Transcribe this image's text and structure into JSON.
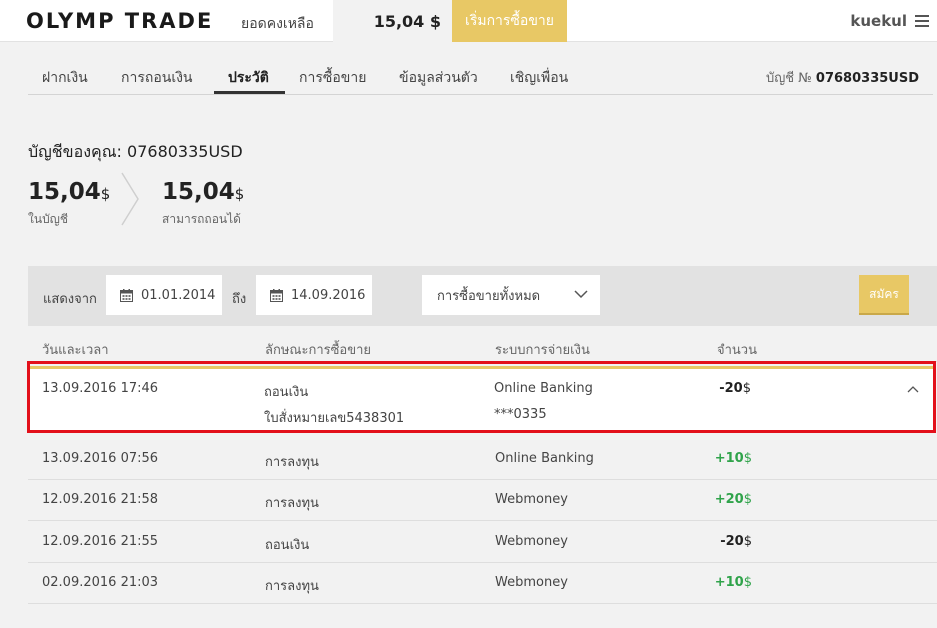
{
  "header": {
    "logo": "OLYMP TRADE",
    "balance_label": "ยอดคงเหลือ",
    "balance_value": "15,04 $",
    "start_trading": "เริ่มการซื้อขาย",
    "username": "kuekul"
  },
  "tabs": [
    {
      "label": "ฝากเงิน"
    },
    {
      "label": "การถอนเงิน"
    },
    {
      "label": "ประวัติ"
    },
    {
      "label": "การซื้อขาย"
    },
    {
      "label": "ข้อมูลส่วนตัว"
    },
    {
      "label": "เชิญเพื่อน"
    }
  ],
  "active_tab": "ประวัติ",
  "account": {
    "label_prefix": "บัญชี №",
    "number": "07680335USD",
    "title": "บัญชีของคุณ: 07680335USD",
    "in_account_value": "15,04",
    "in_account_currency": "$",
    "in_account_label": "ในบัญชี",
    "withdrawable_value": "15,04",
    "withdrawable_currency": "$",
    "withdrawable_label": "สามารถถอนได้"
  },
  "filter": {
    "from_label": "แสดงจาก",
    "from_date": "01.01.2014",
    "to_label": "ถึง",
    "to_date": "14.09.2016",
    "type_select": "การซื้อขายทั้งหมด",
    "apply_label": "สมัคร"
  },
  "table": {
    "headers": {
      "datetime": "วันและเวลา",
      "type": "ลักษณะการซื้อขาย",
      "payment": "ระบบการจ่ายเงิน",
      "amount": "จำนวน"
    },
    "expanded_row": {
      "datetime": "13.09.2016 17:46",
      "type": "ถอนเงิน",
      "order": "ใบสั่งหมายเลข5438301",
      "payment": "Online Banking",
      "account": "***0335",
      "amount": "-20",
      "currency": "$"
    },
    "rows": [
      {
        "datetime": "13.09.2016 07:56",
        "type": "การลงทุน",
        "payment": "Online Banking",
        "amount": "+10",
        "currency": "$"
      },
      {
        "datetime": "12.09.2016 21:58",
        "type": "การลงทุน",
        "payment": "Webmoney",
        "amount": "+20",
        "currency": "$"
      },
      {
        "datetime": "12.09.2016 21:55",
        "type": "ถอนเงิน",
        "payment": "Webmoney",
        "amount": "-20",
        "currency": "$"
      },
      {
        "datetime": "02.09.2016 21:03",
        "type": "การลงทุน",
        "payment": "Webmoney",
        "amount": "+10",
        "currency": "$"
      }
    ]
  },
  "colors": {
    "accent": "#e8c865",
    "positive": "#2fa34a",
    "highlight": "#e3101a"
  }
}
